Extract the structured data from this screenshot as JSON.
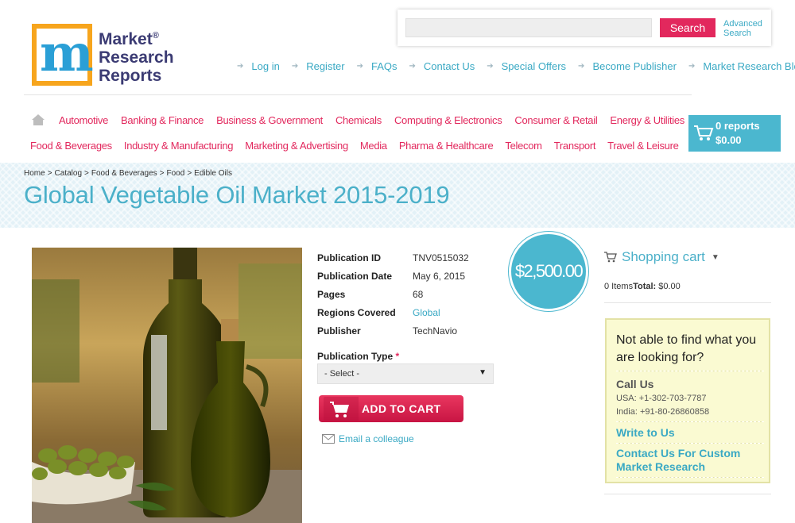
{
  "header": {
    "logo": {
      "line1": "Market",
      "line2": "Research",
      "line3": "Reports",
      "registered": "®"
    },
    "search": {
      "placeholder": "",
      "button": "Search",
      "advanced_line1": "Advanced",
      "advanced_line2": "Search"
    },
    "top_links": [
      "Log in",
      "Register",
      "FAQs",
      "Contact Us",
      "Special Offers",
      "Become Publisher",
      "Market Research Blog"
    ]
  },
  "categories": {
    "row1": [
      "Automotive",
      "Banking & Finance",
      "Business & Government",
      "Chemicals",
      "Computing & Electronics",
      "Consumer & Retail",
      "Energy & Utilities"
    ],
    "row2": [
      "Food & Beverages",
      "Industry & Manufacturing",
      "Marketing & Advertising",
      "Media",
      "Pharma & Healthcare",
      "Telecom",
      "Transport",
      "Travel & Leisure"
    ]
  },
  "cart_header": {
    "reports": "0 reports",
    "amount": "$0.00"
  },
  "breadcrumb": [
    "Home",
    "Catalog",
    "Food & Beverages",
    "Food",
    "Edible Oils"
  ],
  "breadcrumb_sep": ">",
  "page_title": "Global Vegetable Oil Market 2015-2019",
  "details": [
    {
      "label": "Publication ID",
      "value": "TNV0515032"
    },
    {
      "label": "Publication Date",
      "value": "May 6, 2015"
    },
    {
      "label": "Pages",
      "value": "68"
    },
    {
      "label": "Regions Covered",
      "value": "Global"
    },
    {
      "label": "Publisher",
      "value": "TechNavio"
    }
  ],
  "price": "$2,500.00",
  "publication_type": {
    "label": "Publication Type",
    "required": "*",
    "selected": "- Select -"
  },
  "add_to_cart": "ADD TO CART",
  "email_colleague": "Email a colleague",
  "shopping_cart": {
    "title": "Shopping cart",
    "items": "0 Items",
    "total_label": "Total:",
    "total_value": "$0.00"
  },
  "help_box": {
    "title": "Not able to find what you are looking for?",
    "call_us": "Call Us",
    "usa": "USA: +1-302-703-7787",
    "india": "India: +91-80-26860858",
    "write_to_us": "Write to Us",
    "contact_custom": "Contact Us For Custom Market Research"
  },
  "colors": {
    "accent_pink": "#e2285d",
    "accent_teal": "#4bb7cf",
    "logo_orange": "#f7a51d"
  },
  "icons": [
    "home-icon",
    "cart-icon",
    "shopping-cart-icon",
    "email-icon",
    "arrow-icon"
  ]
}
